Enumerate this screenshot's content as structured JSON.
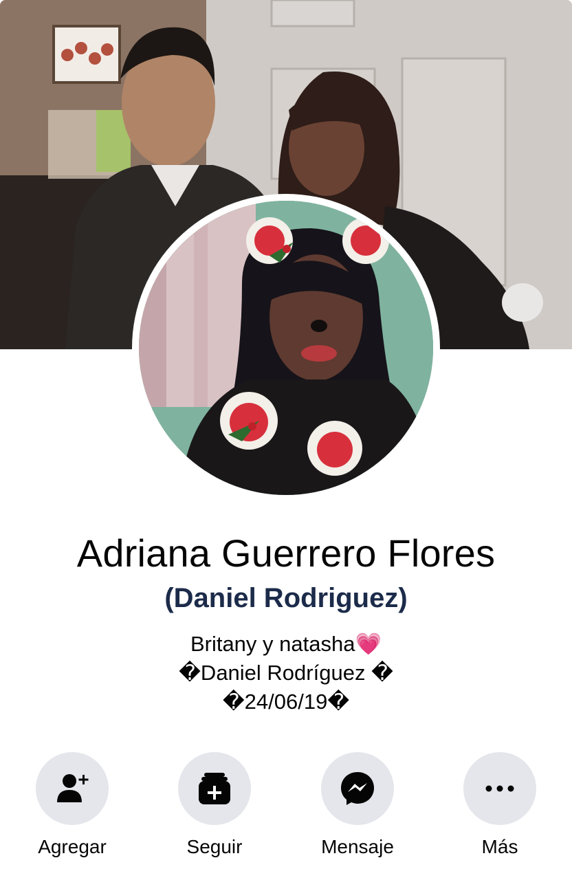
{
  "profile": {
    "name": "Adriana Guerrero Flores",
    "alternate_name": "(Daniel Rodriguez)",
    "bio_lines": [
      "Britany y natasha💗",
      "�Daniel Rodríguez �",
      "�24/06/19�"
    ]
  },
  "actions": [
    {
      "label": "Agregar",
      "icon": "add-friend-icon"
    },
    {
      "label": "Seguir",
      "icon": "follow-icon"
    },
    {
      "label": "Mensaje",
      "icon": "messenger-icon"
    },
    {
      "label": "Más",
      "icon": "more-icon"
    }
  ],
  "colors": {
    "button_bg": "#e4e6eb",
    "icon": "#050505",
    "alt_name": "#1c2b4a"
  }
}
